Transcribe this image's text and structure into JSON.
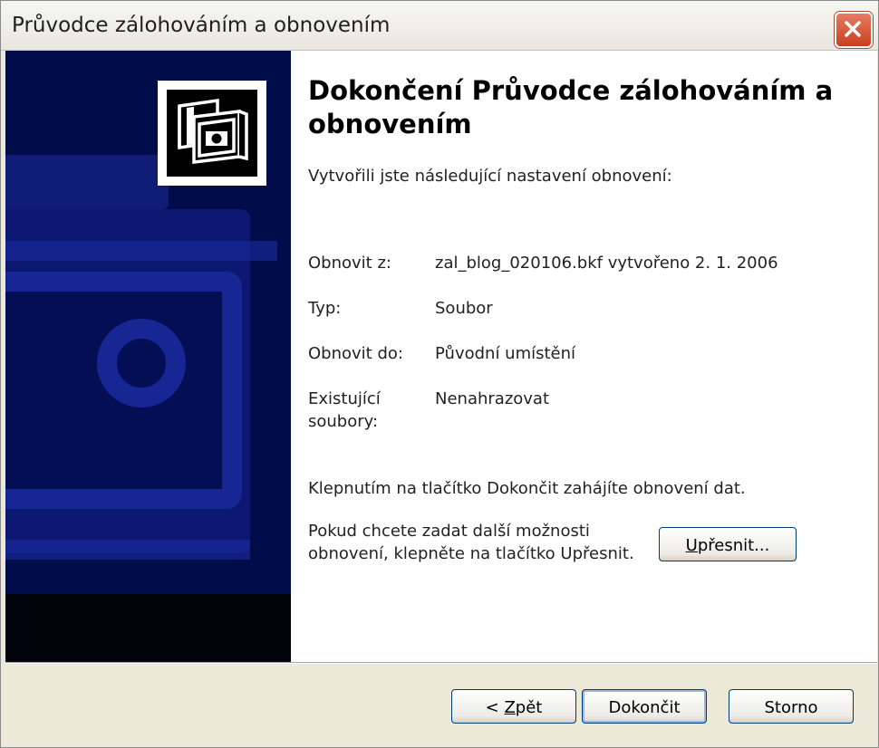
{
  "window": {
    "title": "Průvodce zálohováním a obnovením"
  },
  "icons": {
    "close": "close-icon",
    "wizard_logo": "backup-tape-icon"
  },
  "colors": {
    "banner_background": "#000c4a",
    "close_button": "#d6542f",
    "button_border": "#003c74"
  },
  "main": {
    "heading": "Dokončení Průvodce zálohováním a obnovením",
    "intro": "Vytvořili jste následující nastavení obnovení:",
    "summary": [
      {
        "label": "Obnovit z:",
        "value": "zal_blog_020106.bkf vytvořeno 2. 1. 2006"
      },
      {
        "label": "Typ:",
        "value": "Soubor"
      },
      {
        "label": "Obnovit do:",
        "value": "Původní umístění"
      },
      {
        "label": "Existující soubory:",
        "value": "Nenahrazovat"
      }
    ],
    "finish_hint": "Klepnutím na tlačítko Dokončit zahájíte obnovení dat.",
    "more_options_hint": "Pokud chcete zadat další možnosti obnovení, klepněte na tlačítko Upřesnit.",
    "advanced_button": {
      "mnemonic": "U",
      "rest": "přesnit..."
    }
  },
  "footer": {
    "back_button": {
      "pre": "< ",
      "mnemonic": "Z",
      "rest": "pět"
    },
    "finish_button": "Dokončit",
    "cancel_button": "Storno"
  }
}
